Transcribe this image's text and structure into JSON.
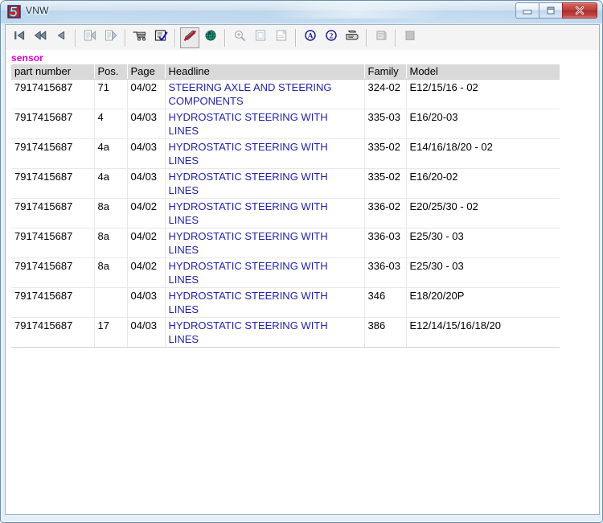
{
  "window": {
    "title": "VNW",
    "app_icon": "app-logo-5-icon",
    "controls": {
      "minimize_label": "Minimize",
      "maximize_label": "Maximize",
      "close_label": "Close",
      "close_glyph": "x"
    },
    "colors": {
      "titlebar_glass": "#bfd7ec",
      "close_button": "#bb3c39",
      "frame_border": "#6a8eae",
      "toolbar_bg": "#f4f4f4",
      "client_bg": "#ffffff"
    }
  },
  "toolbar": {
    "items": [
      {
        "name": "first-record-button",
        "icon": "skip-to-first-icon",
        "state": "enabled",
        "tooltip": "First"
      },
      {
        "name": "fast-rewind-button",
        "icon": "rewind-double-icon",
        "state": "enabled",
        "tooltip": "Back"
      },
      {
        "name": "previous-record-button",
        "icon": "previous-arrow-icon",
        "state": "enabled",
        "tooltip": "Previous"
      },
      {
        "name": "separator-1",
        "icon": "separator",
        "state": "divider",
        "tooltip": ""
      },
      {
        "name": "page-back-button",
        "icon": "document-back-icon",
        "state": "disabled",
        "tooltip": "Page back"
      },
      {
        "name": "page-forward-button",
        "icon": "document-forward-icon",
        "state": "disabled",
        "tooltip": "Page forward"
      },
      {
        "name": "separator-2",
        "icon": "separator",
        "state": "divider",
        "tooltip": ""
      },
      {
        "name": "cart-button",
        "icon": "shopping-cart-icon",
        "state": "enabled",
        "tooltip": "Cart"
      },
      {
        "name": "order-list-button",
        "icon": "checklist-icon",
        "state": "enabled",
        "tooltip": "Order list"
      },
      {
        "name": "separator-3",
        "icon": "separator",
        "state": "divider",
        "tooltip": ""
      },
      {
        "name": "annotate-button",
        "icon": "pen-strike-icon",
        "state": "pressed",
        "tooltip": "Annotate"
      },
      {
        "name": "globe-button",
        "icon": "globe-icon",
        "state": "enabled",
        "tooltip": "Web"
      },
      {
        "name": "separator-4",
        "icon": "separator",
        "state": "divider",
        "tooltip": ""
      },
      {
        "name": "zoom-button",
        "icon": "magnifier-plus-icon",
        "state": "disabled",
        "tooltip": "Zoom"
      },
      {
        "name": "fit-page-button",
        "icon": "page-fit-icon",
        "state": "disabled",
        "tooltip": "Fit page"
      },
      {
        "name": "fit-width-button",
        "icon": "page-width-icon",
        "state": "disabled",
        "tooltip": "Fit width"
      },
      {
        "name": "separator-5",
        "icon": "separator",
        "state": "divider",
        "tooltip": ""
      },
      {
        "name": "text-mode-button",
        "icon": "circled-a-icon",
        "state": "enabled",
        "tooltip": "Text"
      },
      {
        "name": "two-page-button",
        "icon": "circled-2-icon",
        "state": "enabled",
        "tooltip": "Two up"
      },
      {
        "name": "print-button",
        "icon": "printer-icon",
        "state": "enabled",
        "tooltip": "Print"
      },
      {
        "name": "separator-6",
        "icon": "separator",
        "state": "divider",
        "tooltip": ""
      },
      {
        "name": "notes-button",
        "icon": "notepad-icon",
        "state": "disabled",
        "tooltip": "Notes"
      },
      {
        "name": "separator-7",
        "icon": "separator",
        "state": "divider",
        "tooltip": ""
      },
      {
        "name": "stop-button",
        "icon": "stop-square-icon",
        "state": "disabled",
        "tooltip": "Stop"
      }
    ]
  },
  "content": {
    "search_term_label": "sensor",
    "table": {
      "headers": [
        "part number",
        "Pos.",
        "Page",
        "Headline",
        "Family",
        "Model"
      ],
      "rows": [
        {
          "part_number": "7917415687",
          "pos": "71",
          "page": "04/02",
          "headline": "STEERING AXLE AND STEERING COMPONENTS",
          "family": "324-02",
          "model": "E12/15/16 - 02"
        },
        {
          "part_number": "7917415687",
          "pos": "4",
          "page": "04/03",
          "headline": "HYDROSTATIC STEERING WITH LINES",
          "family": "335-03",
          "model": "E16/20-03"
        },
        {
          "part_number": "7917415687",
          "pos": "4a",
          "page": "04/03",
          "headline": "HYDROSTATIC STEERING WITH LINES",
          "family": "335-02",
          "model": "E14/16/18/20 - 02"
        },
        {
          "part_number": "7917415687",
          "pos": "4a",
          "page": "04/03",
          "headline": "HYDROSTATIC STEERING WITH LINES",
          "family": "335-02",
          "model": "E16/20-02"
        },
        {
          "part_number": "7917415687",
          "pos": "8a",
          "page": "04/02",
          "headline": "HYDROSTATIC STEERING WITH LINES",
          "family": "336-02",
          "model": "E20/25/30 - 02"
        },
        {
          "part_number": "7917415687",
          "pos": "8a",
          "page": "04/02",
          "headline": "HYDROSTATIC STEERING WITH LINES",
          "family": "336-03",
          "model": "E25/30 - 03"
        },
        {
          "part_number": "7917415687",
          "pos": "8a",
          "page": "04/02",
          "headline": "HYDROSTATIC STEERING WITH LINES",
          "family": "336-03",
          "model": "E25/30 - 03"
        },
        {
          "part_number": "7917415687",
          "pos": "",
          "page": "04/03",
          "headline": "HYDROSTATIC STEERING WITH LINES",
          "family": "346",
          "model": "E18/20/20P"
        },
        {
          "part_number": "7917415687",
          "pos": "17",
          "page": "04/03",
          "headline": "HYDROSTATIC STEERING WITH LINES",
          "family": "386",
          "model": "E12/14/15/16/18/20"
        }
      ]
    }
  }
}
